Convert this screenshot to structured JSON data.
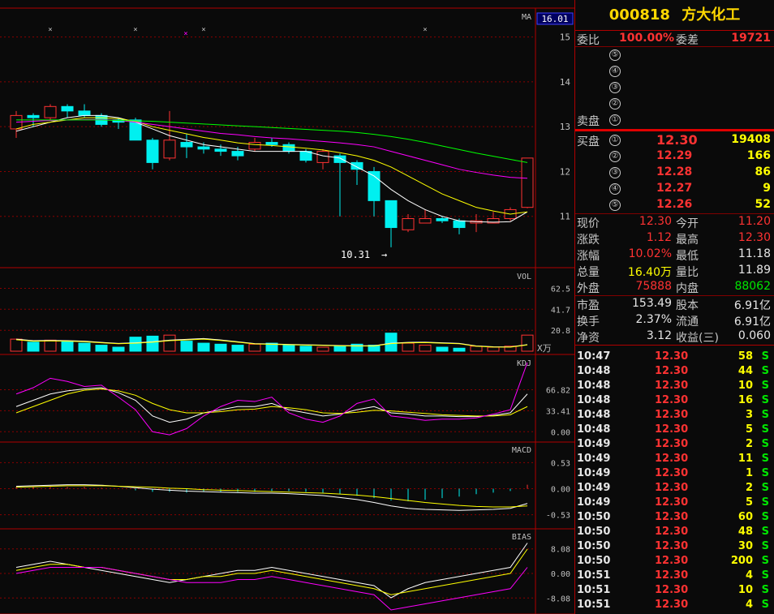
{
  "stock": {
    "code": "000818",
    "name": "方大化工"
  },
  "colors": {
    "up": "#ff3232",
    "down": "#00f0f0",
    "ma1": "#ffffff",
    "ma2": "#ffff00",
    "ma3": "#ff00ff",
    "ma4": "#00ff00",
    "grid": "#8b0000",
    "bg": "#0a0a0a"
  },
  "chart": {
    "panels": {
      "price": {
        "label": "MA",
        "current": "16.01",
        "ticks": [
          "15",
          "14",
          "13",
          "12",
          "11"
        ],
        "low_marker": "10.31"
      },
      "volume": {
        "label": "VOL",
        "ticks": [
          "62.5",
          "41.7",
          "20.8"
        ],
        "unit": "X万"
      },
      "kdj": {
        "label": "KDJ",
        "ticks": [
          "66.82",
          "33.41",
          "0.00"
        ]
      },
      "macd": {
        "label": "MACD",
        "ticks": [
          "0.53",
          "0.00",
          "-0.53"
        ]
      },
      "bias": {
        "label": "BIAS",
        "ticks": [
          "8.08",
          "0.00",
          "-8.08"
        ]
      }
    },
    "candles": [
      {
        "o": 12.95,
        "c": 13.25,
        "h": 13.35,
        "l": 12.75
      },
      {
        "o": 13.25,
        "c": 13.2,
        "h": 13.3,
        "l": 13.0
      },
      {
        "o": 13.2,
        "c": 13.45,
        "h": 13.5,
        "l": 13.15
      },
      {
        "o": 13.45,
        "c": 13.35,
        "h": 13.5,
        "l": 13.2
      },
      {
        "o": 13.35,
        "c": 13.25,
        "h": 13.5,
        "l": 13.2
      },
      {
        "o": 13.25,
        "c": 13.05,
        "h": 13.3,
        "l": 13.0
      },
      {
        "o": 13.15,
        "c": 13.1,
        "h": 13.2,
        "l": 12.95
      },
      {
        "o": 13.15,
        "c": 12.7,
        "h": 13.2,
        "l": 12.7
      },
      {
        "o": 12.7,
        "c": 12.2,
        "h": 12.75,
        "l": 12.05
      },
      {
        "o": 12.3,
        "c": 12.7,
        "h": 13.35,
        "l": 12.25
      },
      {
        "o": 12.65,
        "c": 12.55,
        "h": 12.85,
        "l": 12.3
      },
      {
        "o": 12.55,
        "c": 12.5,
        "h": 12.65,
        "l": 12.4
      },
      {
        "o": 12.5,
        "c": 12.45,
        "h": 12.6,
        "l": 12.35
      },
      {
        "o": 12.45,
        "c": 12.35,
        "h": 12.55,
        "l": 12.25
      },
      {
        "o": 12.5,
        "c": 12.65,
        "h": 12.75,
        "l": 12.45
      },
      {
        "o": 12.65,
        "c": 12.6,
        "h": 12.75,
        "l": 12.55
      },
      {
        "o": 12.6,
        "c": 12.45,
        "h": 12.65,
        "l": 12.4
      },
      {
        "o": 12.45,
        "c": 12.25,
        "h": 12.5,
        "l": 12.2
      },
      {
        "o": 12.2,
        "c": 12.45,
        "h": 12.5,
        "l": 12.05
      },
      {
        "o": 12.35,
        "c": 12.2,
        "h": 12.4,
        "l": 11.0
      },
      {
        "o": 12.2,
        "c": 12.05,
        "h": 12.25,
        "l": 11.7
      },
      {
        "o": 12.0,
        "c": 11.35,
        "h": 12.1,
        "l": 11.0
      },
      {
        "o": 11.35,
        "c": 10.75,
        "h": 11.35,
        "l": 10.31
      },
      {
        "o": 10.7,
        "c": 10.95,
        "h": 11.05,
        "l": 10.65
      },
      {
        "o": 10.85,
        "c": 10.95,
        "h": 11.15,
        "l": 10.85
      },
      {
        "o": 10.95,
        "c": 10.9,
        "h": 11.0,
        "l": 10.85
      },
      {
        "o": 10.9,
        "c": 10.75,
        "h": 10.95,
        "l": 10.6
      },
      {
        "o": 10.85,
        "c": 10.9,
        "h": 11.05,
        "l": 10.65
      },
      {
        "o": 10.85,
        "c": 10.95,
        "h": 11.1,
        "l": 10.85
      },
      {
        "o": 10.95,
        "c": 11.15,
        "h": 11.2,
        "l": 10.9
      },
      {
        "o": 11.2,
        "c": 12.3,
        "h": 12.3,
        "l": 11.18
      }
    ],
    "ma5": [
      12.9,
      13.0,
      13.1,
      13.2,
      13.25,
      13.25,
      13.2,
      13.1,
      12.95,
      12.8,
      12.7,
      12.6,
      12.55,
      12.5,
      12.45,
      12.45,
      12.45,
      12.45,
      12.35,
      12.3,
      12.1,
      11.9,
      11.6,
      11.35,
      11.15,
      11.0,
      10.9,
      10.88,
      10.87,
      10.88,
      11.1
    ],
    "ma10": [
      12.95,
      13.05,
      13.1,
      13.15,
      13.2,
      13.2,
      13.18,
      13.12,
      13.0,
      12.92,
      12.84,
      12.76,
      12.7,
      12.64,
      12.6,
      12.58,
      12.55,
      12.52,
      12.48,
      12.42,
      12.35,
      12.25,
      12.1,
      11.9,
      11.7,
      11.5,
      11.35,
      11.2,
      11.12,
      11.05,
      11.1
    ],
    "ma20": [
      13.1,
      13.12,
      13.14,
      13.15,
      13.16,
      13.16,
      13.14,
      13.1,
      13.05,
      13.0,
      12.95,
      12.9,
      12.85,
      12.82,
      12.78,
      12.75,
      12.73,
      12.7,
      12.67,
      12.64,
      12.6,
      12.55,
      12.45,
      12.35,
      12.25,
      12.15,
      12.05,
      11.98,
      11.92,
      11.87,
      11.85
    ],
    "ma60": [
      13.15,
      13.15,
      13.15,
      13.15,
      13.15,
      13.15,
      13.14,
      13.13,
      13.12,
      13.1,
      13.08,
      13.06,
      13.04,
      13.02,
      13.0,
      12.98,
      12.96,
      12.94,
      12.92,
      12.9,
      12.87,
      12.83,
      12.78,
      12.72,
      12.65,
      12.57,
      12.49,
      12.41,
      12.34,
      12.27,
      12.2
    ],
    "volume": [
      12,
      9,
      11,
      10,
      8,
      6,
      4,
      14,
      15,
      16,
      10,
      8,
      7,
      6,
      7,
      8,
      6,
      5,
      4,
      5,
      7,
      6,
      18,
      8,
      6,
      4,
      3,
      5,
      4,
      5,
      16
    ],
    "kdj_k": [
      40,
      50,
      60,
      65,
      68,
      70,
      62,
      50,
      25,
      15,
      20,
      30,
      35,
      40,
      40,
      45,
      35,
      30,
      25,
      28,
      35,
      40,
      30,
      28,
      25,
      25,
      24,
      24,
      26,
      30,
      60
    ],
    "kdj_d": [
      30,
      40,
      50,
      60,
      66,
      68,
      65,
      58,
      45,
      35,
      30,
      30,
      32,
      35,
      36,
      40,
      38,
      35,
      30,
      29,
      31,
      34,
      33,
      31,
      29,
      27,
      26,
      25,
      25,
      27,
      40
    ],
    "kdj_j": [
      60,
      70,
      85,
      80,
      72,
      74,
      55,
      35,
      0,
      -5,
      5,
      25,
      40,
      50,
      48,
      55,
      30,
      20,
      15,
      25,
      45,
      52,
      25,
      22,
      18,
      20,
      20,
      22,
      28,
      35,
      110
    ],
    "macd_dif": [
      0.05,
      0.06,
      0.07,
      0.08,
      0.08,
      0.07,
      0.05,
      0.02,
      -0.01,
      -0.03,
      -0.05,
      -0.06,
      -0.07,
      -0.08,
      -0.09,
      -0.09,
      -0.1,
      -0.12,
      -0.14,
      -0.18,
      -0.22,
      -0.28,
      -0.35,
      -0.4,
      -0.42,
      -0.43,
      -0.44,
      -0.43,
      -0.42,
      -0.4,
      -0.3
    ],
    "macd_dea": [
      0.03,
      0.04,
      0.05,
      0.06,
      0.06,
      0.06,
      0.05,
      0.04,
      0.03,
      0.01,
      0.0,
      -0.02,
      -0.03,
      -0.04,
      -0.05,
      -0.06,
      -0.07,
      -0.08,
      -0.09,
      -0.11,
      -0.13,
      -0.16,
      -0.2,
      -0.24,
      -0.28,
      -0.31,
      -0.34,
      -0.36,
      -0.37,
      -0.37,
      -0.35
    ],
    "bias1": [
      2,
      3,
      4,
      3,
      2,
      1,
      0,
      -1,
      -2,
      -3,
      -2,
      -1,
      0,
      1,
      1,
      2,
      1,
      0,
      -1,
      -2,
      -3,
      -4,
      -8,
      -5,
      -3,
      -2,
      -1,
      0,
      1,
      2,
      10
    ],
    "bias2": [
      1,
      2,
      3,
      3,
      2,
      2,
      1,
      0,
      -1,
      -2,
      -2,
      -1,
      -1,
      0,
      0,
      1,
      0,
      -1,
      -2,
      -3,
      -4,
      -5,
      -7,
      -6,
      -5,
      -4,
      -3,
      -2,
      -1,
      0,
      8
    ],
    "bias3": [
      0,
      1,
      2,
      2,
      2,
      2,
      1,
      0,
      -1,
      -2,
      -3,
      -3,
      -3,
      -2,
      -2,
      -1,
      -2,
      -3,
      -4,
      -5,
      -6,
      -7,
      -12,
      -11,
      -10,
      -9,
      -8,
      -7,
      -6,
      -5,
      2
    ]
  },
  "quote": {
    "weibi": {
      "label": "委比",
      "value": "100.00%"
    },
    "weicha": {
      "label": "委差",
      "value": "19721"
    },
    "sell_label": "卖盘",
    "buy_label": "买盘",
    "sell": [
      {
        "n": "⑤"
      },
      {
        "n": "④"
      },
      {
        "n": "③"
      },
      {
        "n": "②"
      },
      {
        "n": "①"
      }
    ],
    "buy": [
      {
        "n": "①",
        "price": "12.30",
        "vol": "19408"
      },
      {
        "n": "②",
        "price": "12.29",
        "vol": "166"
      },
      {
        "n": "③",
        "price": "12.28",
        "vol": "86"
      },
      {
        "n": "④",
        "price": "12.27",
        "vol": "9"
      },
      {
        "n": "⑤",
        "price": "12.26",
        "vol": "52"
      }
    ],
    "stats": [
      {
        "l1": "现价",
        "v1": "12.30",
        "c1": "red",
        "l2": "今开",
        "v2": "11.20",
        "c2": "red"
      },
      {
        "l1": "涨跌",
        "v1": "1.12",
        "c1": "red",
        "l2": "最高",
        "v2": "12.30",
        "c2": "red"
      },
      {
        "l1": "涨幅",
        "v1": "10.02%",
        "c1": "red",
        "l2": "最低",
        "v2": "11.18",
        "c2": "white"
      },
      {
        "l1": "总量",
        "v1": "16.40万",
        "c1": "yellow",
        "l2": "量比",
        "v2": "11.89",
        "c2": "white"
      },
      {
        "l1": "外盘",
        "v1": "75888",
        "c1": "red",
        "l2": "内盘",
        "v2": "88062",
        "c2": "green"
      }
    ],
    "stats2": [
      {
        "l1": "市盈",
        "v1": "153.49",
        "l2": "股本",
        "v2": "6.91亿"
      },
      {
        "l1": "换手",
        "v1": "2.37%",
        "l2": "流通",
        "v2": "6.91亿"
      },
      {
        "l1": "净资",
        "v1": "3.12",
        "l2": "收益(三)",
        "v2": "0.060"
      }
    ],
    "ticks": [
      {
        "t": "10:47",
        "p": "12.30",
        "v": "58",
        "s": "S"
      },
      {
        "t": "10:48",
        "p": "12.30",
        "v": "44",
        "s": "S"
      },
      {
        "t": "10:48",
        "p": "12.30",
        "v": "10",
        "s": "S"
      },
      {
        "t": "10:48",
        "p": "12.30",
        "v": "16",
        "s": "S"
      },
      {
        "t": "10:48",
        "p": "12.30",
        "v": "3",
        "s": "S"
      },
      {
        "t": "10:48",
        "p": "12.30",
        "v": "5",
        "s": "S"
      },
      {
        "t": "10:49",
        "p": "12.30",
        "v": "2",
        "s": "S"
      },
      {
        "t": "10:49",
        "p": "12.30",
        "v": "11",
        "s": "S"
      },
      {
        "t": "10:49",
        "p": "12.30",
        "v": "1",
        "s": "S"
      },
      {
        "t": "10:49",
        "p": "12.30",
        "v": "2",
        "s": "S"
      },
      {
        "t": "10:49",
        "p": "12.30",
        "v": "5",
        "s": "S"
      },
      {
        "t": "10:50",
        "p": "12.30",
        "v": "60",
        "s": "S"
      },
      {
        "t": "10:50",
        "p": "12.30",
        "v": "48",
        "s": "S"
      },
      {
        "t": "10:50",
        "p": "12.30",
        "v": "30",
        "s": "S"
      },
      {
        "t": "10:50",
        "p": "12.30",
        "v": "200",
        "s": "S"
      },
      {
        "t": "10:51",
        "p": "12.30",
        "v": "4",
        "s": "S"
      },
      {
        "t": "10:51",
        "p": "12.30",
        "v": "10",
        "s": "S"
      },
      {
        "t": "10:51",
        "p": "12.30",
        "v": "4",
        "s": "S"
      }
    ]
  }
}
